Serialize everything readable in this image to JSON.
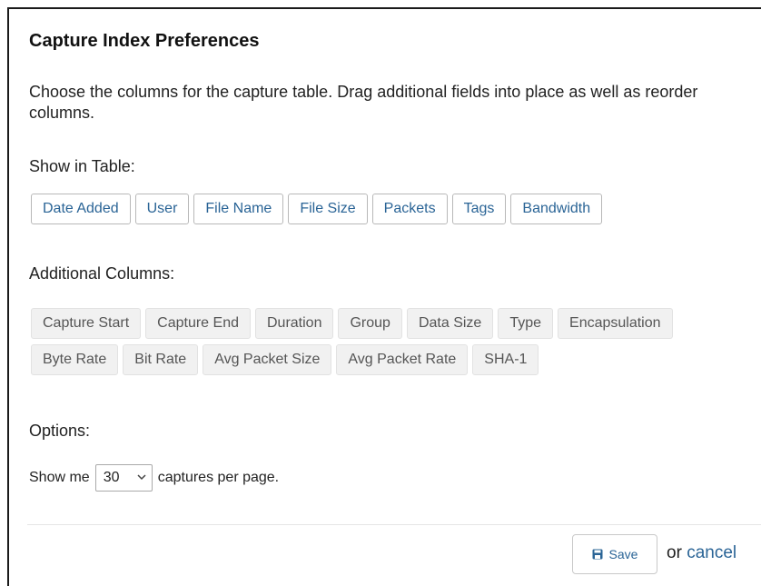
{
  "dialog": {
    "title": "Capture Index Preferences",
    "description": "Choose the columns for the capture table. Drag additional fields into place as well as reorder columns."
  },
  "show_in_table": {
    "label": "Show in Table:",
    "columns": [
      "Date Added",
      "User",
      "File Name",
      "File Size",
      "Packets",
      "Tags",
      "Bandwidth"
    ]
  },
  "additional_columns": {
    "label": "Additional Columns:",
    "row1": [
      "Capture Start",
      "Capture End",
      "Duration",
      "Group",
      "Data Size",
      "Type",
      "Encapsulation"
    ],
    "row2": [
      "Byte Rate",
      "Bit Rate",
      "Avg Packet Size",
      "Avg Packet Rate",
      "SHA-1"
    ]
  },
  "options": {
    "label": "Options:",
    "prefix": "Show me",
    "per_page_value": "30",
    "suffix": "captures per page."
  },
  "footer": {
    "save_label": "Save",
    "or_text": "or",
    "cancel_label": "cancel"
  },
  "colors": {
    "link": "#2a6496",
    "chip_inactive_bg": "#f1f1f1"
  },
  "icons": {
    "save": "floppy-disk-icon",
    "select": "chevron-down-icon"
  }
}
